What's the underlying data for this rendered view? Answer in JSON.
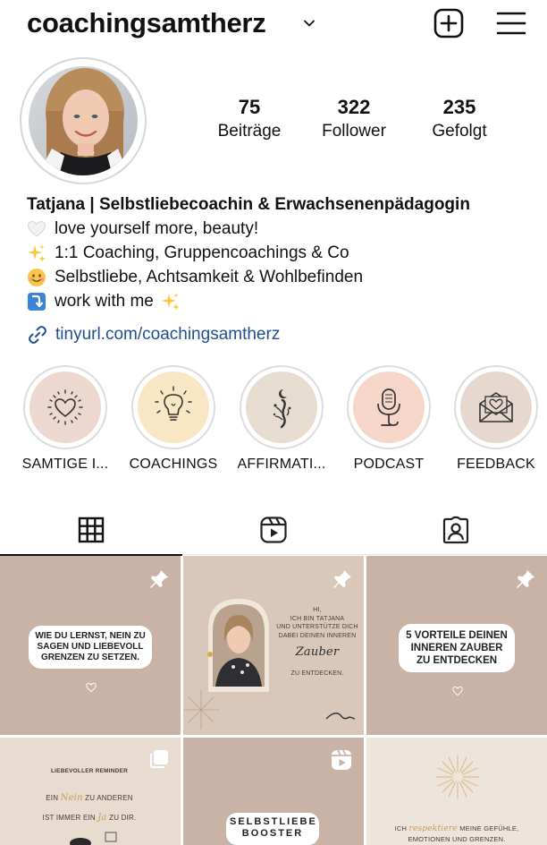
{
  "header": {
    "username": "coachingsamtherz"
  },
  "stats": [
    {
      "value": "75",
      "label": "Beiträge"
    },
    {
      "value": "322",
      "label": "Follower"
    },
    {
      "value": "235",
      "label": "Gefolgt"
    }
  ],
  "bio": {
    "name": "Tatjana | Selbstliebecoachin & Erwachsenenpädagogin",
    "lines": [
      {
        "icon": "white-heart-icon",
        "text": "love yourself more, beauty!"
      },
      {
        "icon": "sparkles-icon",
        "text": "1:1 Coaching, Gruppencoachings & Co"
      },
      {
        "icon": "smiling-face-icon",
        "text": "Selbstliebe, Achtsamkeit & Wohlbefinden"
      },
      {
        "icon": "arrow-down-icon",
        "text": "work with me"
      }
    ],
    "link": "tinyurl.com/coachingsamtherz"
  },
  "highlights": [
    {
      "label": "SAMTIGE I...",
      "bg": "#ecd8cf",
      "icon": "heart-doodle-icon"
    },
    {
      "label": "COACHINGS",
      "bg": "#f9e6c4",
      "icon": "lightbulb-icon"
    },
    {
      "label": "AFFIRMATI...",
      "bg": "#e7dcd0",
      "icon": "moon-flower-icon"
    },
    {
      "label": "PODCAST",
      "bg": "#f6d6c8",
      "icon": "microphone-icon"
    },
    {
      "label": "FEEDBACK",
      "bg": "#e6d8cf",
      "icon": "envelope-heart-icon"
    }
  ],
  "tabs": [
    {
      "name": "grid-icon",
      "active": true
    },
    {
      "name": "reels-icon",
      "active": false
    },
    {
      "name": "tagged-icon",
      "active": false
    }
  ],
  "posts": {
    "p1": {
      "text": "WIE DU LERNST, NEIN ZU SAGEN UND LIEBEVOLL GRENZEN ZU SETZEN."
    },
    "p2": {
      "line1": "HI,",
      "line2": "ICH BIN TATJANA",
      "line3": "UND UNTERSTÜTZE DICH",
      "line4": "DABEI DEINEN INNEREN",
      "script": "Zauber",
      "line5": "ZU ENTDECKEN."
    },
    "p3": {
      "text": "5 VORTEILE DEINEN INNEREN ZAUBER ZU ENTDECKEN"
    },
    "p4": {
      "title": "LIEBEVOLLER REMINDER",
      "l1a": "EIN",
      "l1s": "Nein",
      "l1b": "ZU ANDEREN",
      "l2a": "IST IMMER EIN",
      "l2s": "Ja",
      "l2b": "ZU DIR."
    },
    "p5": {
      "l1": "SELBSTLIEBE",
      "l2": "BOOSTER"
    },
    "p6": {
      "a": "ICH",
      "s": "respektiere",
      "b": "MEINE GEFÜHLE,",
      "c": "EMOTIONEN UND GRENZEN."
    }
  },
  "colors": {
    "link": "#1f4f8f",
    "post_bg": "#c9b3a6",
    "post_bg_light": "#e7dcd3"
  }
}
